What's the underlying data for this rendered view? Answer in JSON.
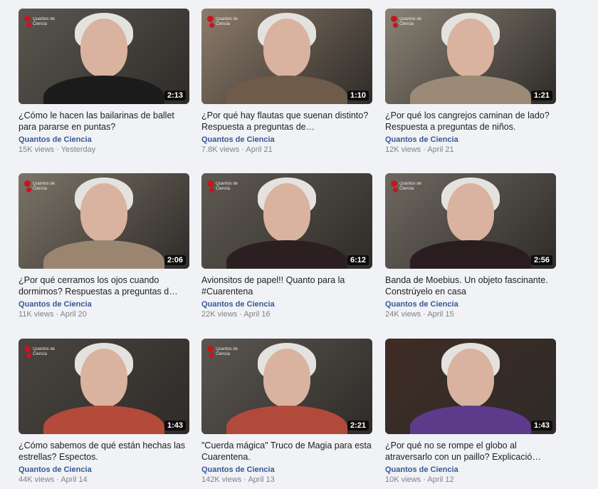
{
  "videos": [
    {
      "title": "¿Cómo le hacen las bailarinas de ballet para pararse en puntas?",
      "channel": "Quantos de Ciencia",
      "views": "15K views",
      "date": "Yesterday",
      "duration": "2:13",
      "bg": "#5a5750",
      "shirt": "#1b1b1b",
      "logo_text": "Quantos de Ciencia"
    },
    {
      "title": "¿Por qué hay flautas que suenan distinto? Respuesta a preguntas de…",
      "channel": "Quantos de Ciencia",
      "views": "7.8K views",
      "date": "April 21",
      "duration": "1:10",
      "bg": "#8c7b6a",
      "shirt": "#6f5b49",
      "logo_text": "Quantos de Ciencia"
    },
    {
      "title": "¿Por qué los cangrejos caminan de lado? Respuesta a preguntas de niños.",
      "channel": "Quantos de Ciencia",
      "views": "12K views",
      "date": "April 21",
      "duration": "1:21",
      "bg": "#8a8275",
      "shirt": "#9a8a76",
      "logo_text": "Quantos de Ciencia"
    },
    {
      "title": "¿Por qué cerramos los ojos cuando dormimos? Respuestas a preguntas d…",
      "channel": "Quantos de Ciencia",
      "views": "11K views",
      "date": "April 20",
      "duration": "2:06",
      "bg": "#7c7468",
      "shirt": "#9a8670",
      "logo_text": "Quantos de Ciencia"
    },
    {
      "title": "Avionsitos de papel!! Quanto para la #Cuarentena",
      "channel": "Quantos de Ciencia",
      "views": "22K views",
      "date": "April 16",
      "duration": "6:12",
      "bg": "#5f5a52",
      "shirt": "#2c1f22",
      "logo_text": "Quantos de Ciencia"
    },
    {
      "title": "Banda de Moebius. Un objeto fascinante. Constrúyelo en casa",
      "channel": "Quantos de Ciencia",
      "views": "24K views",
      "date": "April 15",
      "duration": "2:56",
      "bg": "#6e6860",
      "shirt": "#2a1d20",
      "logo_text": "Quantos de Ciencia"
    },
    {
      "title": "¿Cómo sabemos de qué están hechas las estrellas? Espectos.",
      "channel": "Quantos de Ciencia",
      "views": "44K views",
      "date": "April 14",
      "duration": "1:43",
      "bg": "#4a4540",
      "shirt": "#b44a3a",
      "logo_text": "Quantos de Ciencia"
    },
    {
      "title": "\"Cuerda mágica\" Truco de Magia para esta Cuarentena.",
      "channel": "Quantos de Ciencia",
      "views": "142K views",
      "date": "April 13",
      "duration": "2:21",
      "bg": "#5b5650",
      "shirt": "#b24a3c",
      "logo_text": "Quantos de Ciencia"
    },
    {
      "title": "¿Por qué no se rompe el globo al atraversarlo con un paillo? Explicació…",
      "channel": "Quantos de Ciencia",
      "views": "10K views",
      "date": "April 12",
      "duration": "1:43",
      "bg": "#3f2c25",
      "shirt": "#5e3a8a",
      "logo_text": ""
    }
  ]
}
